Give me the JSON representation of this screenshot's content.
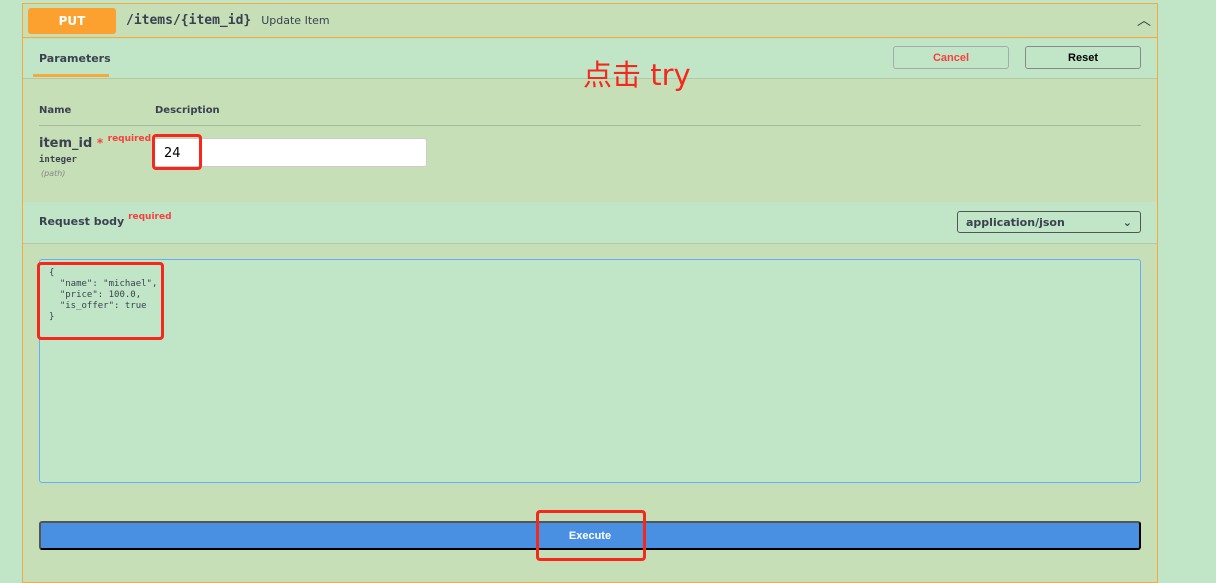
{
  "operation": {
    "method": "PUT",
    "path": "/items/{item_id}",
    "summary": "Update Item"
  },
  "tabs": {
    "parameters": "Parameters",
    "cancel": "Cancel",
    "reset": "Reset"
  },
  "annotation": "点击 try",
  "params": {
    "col_name": "Name",
    "col_desc": "Description",
    "name": "item_id",
    "star": "*",
    "required": "required",
    "type": "integer",
    "in": "(path)",
    "value": "24"
  },
  "request_body": {
    "title": "Request body",
    "required": "required",
    "content_type": "application/json",
    "chevron": "⌄",
    "json": "{\n  \"name\": \"michael\",\n  \"price\": 100.0,\n  \"is_offer\": true\n}"
  },
  "execute": "Execute",
  "colors": {
    "put": "#fca130",
    "execute": "#4990e2",
    "highlight": "#f5281e"
  }
}
